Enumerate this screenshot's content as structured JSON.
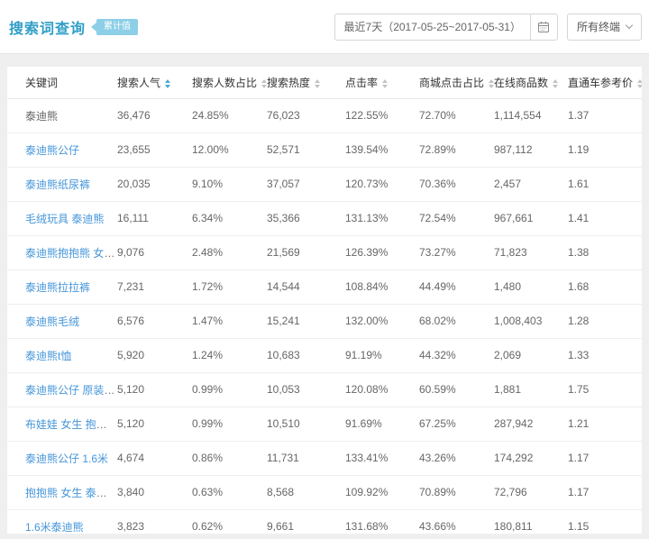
{
  "page": {
    "title": "搜索词查询",
    "badge": "累计值"
  },
  "toolbar": {
    "date_range": "最近7天（2017-05-25~2017-05-31）",
    "terminal_selector": "所有终端"
  },
  "icons": {
    "calendar": "calendar-icon",
    "chevron": "chevron-down-icon",
    "sort": "sort-carets-icon"
  },
  "colors": {
    "title": "#2f9ec7",
    "badge_bg": "#8ccfe7",
    "link": "#4696d9",
    "sort_active": "#49a9d8",
    "page_bg": "#efeff0"
  },
  "table": {
    "columns": [
      {
        "key": "keyword",
        "label": "关键词",
        "sortable": false,
        "sort_active": false
      },
      {
        "key": "search_popularity",
        "label": "搜索人气",
        "sortable": true,
        "sort_active": true
      },
      {
        "key": "searcher_ratio",
        "label": "搜索人数占比",
        "sortable": true,
        "sort_active": false
      },
      {
        "key": "search_heat",
        "label": "搜索热度",
        "sortable": true,
        "sort_active": false
      },
      {
        "key": "ctr",
        "label": "点击率",
        "sortable": true,
        "sort_active": false
      },
      {
        "key": "mall_click_ratio",
        "label": "商城点击占比",
        "sortable": true,
        "sort_active": false
      },
      {
        "key": "online_products",
        "label": "在线商品数",
        "sortable": true,
        "sort_active": false
      },
      {
        "key": "ppc_ref_price",
        "label": "直通车参考价",
        "sortable": true,
        "sort_active": false
      }
    ],
    "rows": [
      {
        "keyword": "泰迪熊",
        "link": false,
        "values": [
          "36,476",
          "24.85%",
          "76,023",
          "122.55%",
          "72.70%",
          "1,114,554",
          "1.37"
        ]
      },
      {
        "keyword": "泰迪熊公仔",
        "link": true,
        "values": [
          "23,655",
          "12.00%",
          "52,571",
          "139.54%",
          "72.89%",
          "987,112",
          "1.19"
        ]
      },
      {
        "keyword": "泰迪熊纸尿裤",
        "link": true,
        "values": [
          "20,035",
          "9.10%",
          "37,057",
          "120.73%",
          "70.36%",
          "2,457",
          "1.61"
        ]
      },
      {
        "keyword": "毛绒玩具 泰迪熊",
        "link": true,
        "values": [
          "16,111",
          "6.34%",
          "35,366",
          "131.13%",
          "72.54%",
          "967,661",
          "1.41"
        ]
      },
      {
        "keyword": "泰迪熊抱抱熊 女生 送...",
        "link": true,
        "values": [
          "9,076",
          "2.48%",
          "21,569",
          "126.39%",
          "73.27%",
          "71,823",
          "1.38"
        ]
      },
      {
        "keyword": "泰迪熊拉拉裤",
        "link": true,
        "values": [
          "7,231",
          "1.72%",
          "14,544",
          "108.84%",
          "44.49%",
          "1,480",
          "1.68"
        ]
      },
      {
        "keyword": "泰迪熊毛绒",
        "link": true,
        "values": [
          "6,576",
          "1.47%",
          "15,241",
          "132.00%",
          "68.02%",
          "1,008,403",
          "1.28"
        ]
      },
      {
        "keyword": "泰迪熊t恤",
        "link": true,
        "values": [
          "5,920",
          "1.24%",
          "10,683",
          "91.19%",
          "44.32%",
          "2,069",
          "1.33"
        ]
      },
      {
        "keyword": "泰迪熊公仔 原装正版",
        "link": true,
        "values": [
          "5,120",
          "0.99%",
          "10,053",
          "120.08%",
          "60.59%",
          "1,881",
          "1.75"
        ]
      },
      {
        "keyword": "布娃娃 女生 抱抱熊 泰...",
        "link": true,
        "values": [
          "5,120",
          "0.99%",
          "10,510",
          "91.69%",
          "67.25%",
          "287,942",
          "1.21"
        ]
      },
      {
        "keyword": "泰迪熊公仔 1.6米",
        "link": true,
        "values": [
          "4,674",
          "0.86%",
          "11,731",
          "133.41%",
          "43.26%",
          "174,292",
          "1.17"
        ]
      },
      {
        "keyword": "抱抱熊 女生 泰迪熊 送...",
        "link": true,
        "values": [
          "3,840",
          "0.63%",
          "8,568",
          "109.92%",
          "70.89%",
          "72,796",
          "1.17"
        ]
      },
      {
        "keyword": "1.6米泰迪熊",
        "link": true,
        "values": [
          "3,823",
          "0.62%",
          "9,661",
          "131.68%",
          "43.66%",
          "180,811",
          "1.15"
        ]
      }
    ]
  }
}
